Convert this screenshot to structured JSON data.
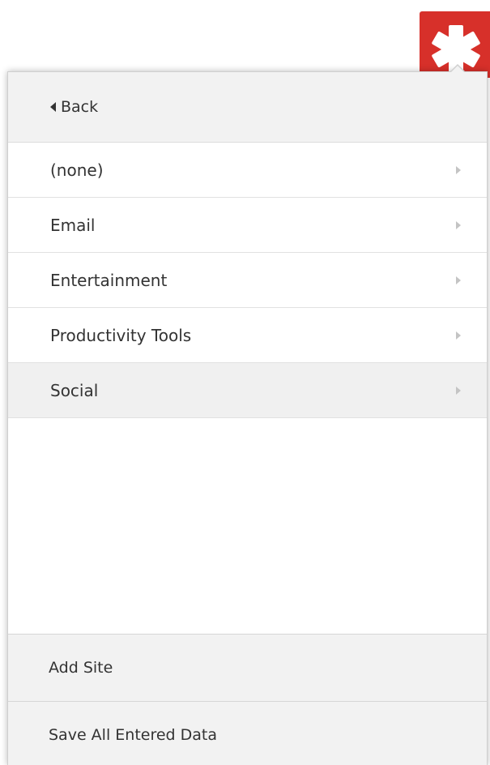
{
  "extension": {
    "icon": "lastpass-asterisk-icon",
    "color": "#d7302a"
  },
  "popup": {
    "back_label": "Back",
    "categories": [
      {
        "label": "(none)",
        "active": false
      },
      {
        "label": "Email",
        "active": false
      },
      {
        "label": "Entertainment",
        "active": false
      },
      {
        "label": "Productivity Tools",
        "active": false
      },
      {
        "label": "Social",
        "active": true
      }
    ],
    "footer": {
      "add_site_label": "Add Site",
      "save_all_label": "Save All Entered Data"
    }
  }
}
